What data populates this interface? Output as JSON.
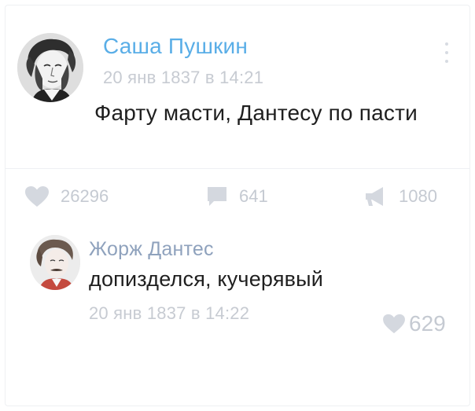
{
  "post": {
    "author": "Саша Пушкин",
    "date": "20 янв 1837 в 14:21",
    "text": "Фарту масти, Дантесу по пасти",
    "avatar_icon": "portrait-avatar",
    "more_icon": "more-vertical-icon"
  },
  "actions": {
    "likes": "26296",
    "comments": "641",
    "shares": "1080",
    "icons": {
      "like": "heart-icon",
      "comment": "comment-icon",
      "share": "megaphone-icon"
    }
  },
  "comment": {
    "author": "Жорж Дантес",
    "text": "допизделся, кучерявый",
    "date": "20 янв 1837 в 14:22",
    "likes": "629",
    "avatar_icon": "portrait-avatar"
  },
  "colors": {
    "accent": "#5aaee7",
    "secondary_name": "#8fa2bd",
    "muted": "#c5cad2",
    "text": "#1f1f1f"
  }
}
